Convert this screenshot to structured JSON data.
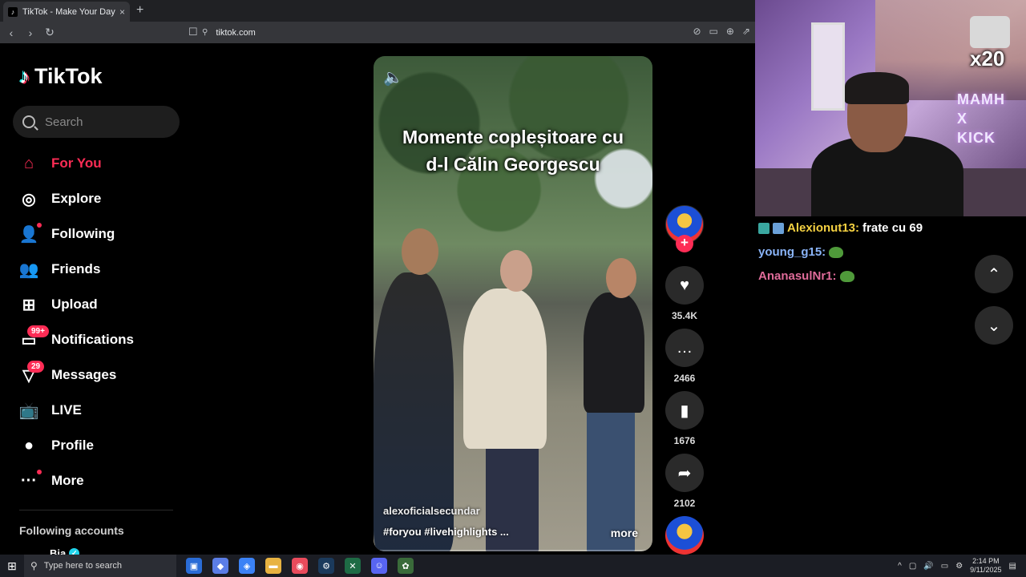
{
  "browser": {
    "tab_title": "TikTok - Make Your Day",
    "tab_close": "×",
    "new_tab": "+",
    "url": "tiktok.com"
  },
  "sidebar": {
    "logo_text": "TikTok",
    "search_placeholder": "Search",
    "nav": [
      {
        "label": "For You",
        "icon": "home-icon",
        "active": true
      },
      {
        "label": "Explore",
        "icon": "compass-icon"
      },
      {
        "label": "Following",
        "icon": "following-icon"
      },
      {
        "label": "Friends",
        "icon": "friends-icon"
      },
      {
        "label": "Upload",
        "icon": "upload-icon"
      },
      {
        "label": "Notifications",
        "icon": "notifications-icon",
        "badge": "99+"
      },
      {
        "label": "Messages",
        "icon": "messages-icon",
        "badge": "29"
      },
      {
        "label": "LIVE",
        "icon": "live-icon"
      },
      {
        "label": "Profile",
        "icon": "profile-icon"
      },
      {
        "label": "More",
        "icon": "more-icon"
      }
    ],
    "following_title": "Following accounts",
    "following_account": "Bia"
  },
  "video": {
    "caption_line1": "Momente copleșitoare cu",
    "caption_line2": "d-l Călin Georgescu",
    "author": "alexoficialsecundar",
    "tags": "#foryou  #livehighlights  ...",
    "more": "more"
  },
  "actions": {
    "likes": "35.4K",
    "comments": "2466",
    "saves": "1676",
    "shares": "2102",
    "follow_plus": "+"
  },
  "stream": {
    "multiplier": "x20",
    "neon_line1": "MAMH",
    "neon_line2": "X",
    "neon_line3": "KICK",
    "chat": [
      {
        "user": "Alexionut13:",
        "color": "#f5d142",
        "message": "frate cu 69"
      },
      {
        "user": "young_g15:",
        "color": "#8ab4f8",
        "message": ""
      },
      {
        "user": "AnanasulNr1:",
        "color": "#e06c9a",
        "message": ""
      }
    ]
  },
  "taskbar": {
    "search_placeholder": "Type here to search",
    "time": "2:14 PM",
    "date": "9/11/2025"
  },
  "colors": {
    "accent": "#fe2c55",
    "badge_cyan": "#20d5ec"
  }
}
